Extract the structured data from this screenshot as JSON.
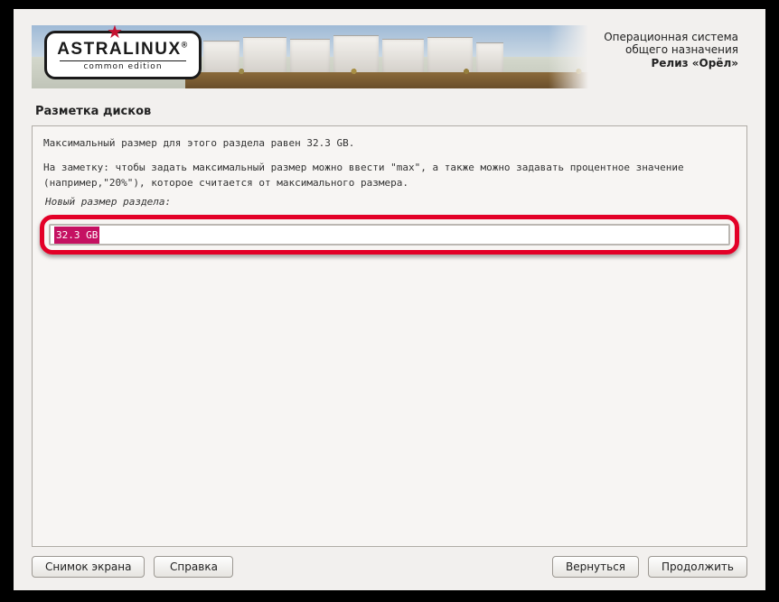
{
  "logo": {
    "main": "ASTRALINUX",
    "sub": "common edition",
    "reg": "®"
  },
  "banner": {
    "line1": "Операционная система",
    "line2": "общего назначения",
    "line3": "Релиз «Орёл»"
  },
  "section_title": "Разметка дисков",
  "content": {
    "max_msg": "Максимальный размер для этого раздела равен 32.3 GB.",
    "note_msg": "На заметку: чтобы задать максимальный размер можно ввести \"max\", а также можно задавать процентное значение (например,\"20%\"), которое считается от максимального размера.",
    "field_label": "Новый размер раздела:",
    "input_value": "32.3 GB"
  },
  "buttons": {
    "screenshot": "Снимок экрана",
    "help": "Справка",
    "back": "Вернуться",
    "continue": "Продолжить"
  }
}
